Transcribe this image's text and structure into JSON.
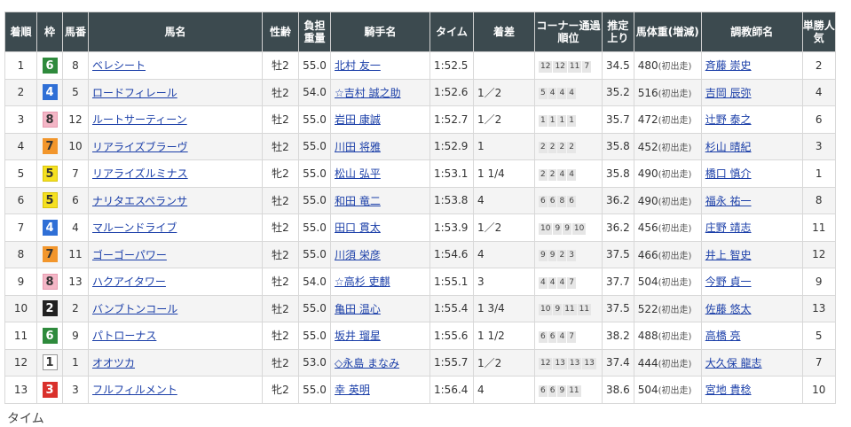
{
  "headers": [
    "着順",
    "枠",
    "馬番",
    "馬名",
    "性齢",
    "負担重量",
    "騎手名",
    "タイム",
    "着差",
    "コーナー通過順位",
    "推定上り",
    "馬体重(増減)",
    "調教師名",
    "単勝人気"
  ],
  "waku_colors": {
    "1": {
      "bg": "#ffffff",
      "fg": "#333333",
      "border": "#999999"
    },
    "2": {
      "bg": "#222222",
      "fg": "#ffffff",
      "border": "#222222"
    },
    "3": {
      "bg": "#d9302b",
      "fg": "#ffffff",
      "border": "#d9302b"
    },
    "4": {
      "bg": "#2f6fd6",
      "fg": "#ffffff",
      "border": "#2f6fd6"
    },
    "5": {
      "bg": "#f5e020",
      "fg": "#333333",
      "border": "#d9c40a"
    },
    "6": {
      "bg": "#2e8a3c",
      "fg": "#ffffff",
      "border": "#2e8a3c"
    },
    "7": {
      "bg": "#f2962c",
      "fg": "#333333",
      "border": "#f2962c"
    },
    "8": {
      "bg": "#f4b6c6",
      "fg": "#333333",
      "border": "#e79ab0"
    }
  },
  "rows": [
    {
      "pos": "1",
      "waku": "6",
      "num": "8",
      "name": "ベレシート",
      "sex": "牡2",
      "load": "55.0",
      "jockey": "北村 友一",
      "time": "1:52.5",
      "margin": "",
      "corner": [
        "12",
        "12",
        "11",
        "7"
      ],
      "last": "34.5",
      "weight": "480",
      "weight_diff": "(初出走)",
      "trainer": "斉藤 崇史",
      "pop": "2"
    },
    {
      "pos": "2",
      "waku": "4",
      "num": "5",
      "name": "ロードフィレール",
      "sex": "牡2",
      "load": "54.0",
      "jockey": "☆吉村 誠之助",
      "time": "1:52.6",
      "margin": "1／2",
      "corner": [
        "5",
        "4",
        "4",
        "4"
      ],
      "last": "35.2",
      "weight": "516",
      "weight_diff": "(初出走)",
      "trainer": "吉岡 辰弥",
      "pop": "4"
    },
    {
      "pos": "3",
      "waku": "8",
      "num": "12",
      "name": "ルートサーティーン",
      "sex": "牡2",
      "load": "55.0",
      "jockey": "岩田 康誠",
      "time": "1:52.7",
      "margin": "1／2",
      "corner": [
        "1",
        "1",
        "1",
        "1"
      ],
      "last": "35.7",
      "weight": "472",
      "weight_diff": "(初出走)",
      "trainer": "辻野 泰之",
      "pop": "6"
    },
    {
      "pos": "4",
      "waku": "7",
      "num": "10",
      "name": "リアライズブラーヴ",
      "sex": "牡2",
      "load": "55.0",
      "jockey": "川田 将雅",
      "time": "1:52.9",
      "margin": "1",
      "corner": [
        "2",
        "2",
        "2",
        "2"
      ],
      "last": "35.8",
      "weight": "452",
      "weight_diff": "(初出走)",
      "trainer": "杉山 晴紀",
      "pop": "3"
    },
    {
      "pos": "5",
      "waku": "5",
      "num": "7",
      "name": "リアライズルミナス",
      "sex": "牝2",
      "load": "55.0",
      "jockey": "松山 弘平",
      "time": "1:53.1",
      "margin": "1 1/4",
      "corner": [
        "2",
        "2",
        "4",
        "4"
      ],
      "last": "35.8",
      "weight": "490",
      "weight_diff": "(初出走)",
      "trainer": "橋口 慎介",
      "pop": "1"
    },
    {
      "pos": "6",
      "waku": "5",
      "num": "6",
      "name": "ナリタエスペランサ",
      "sex": "牡2",
      "load": "55.0",
      "jockey": "和田 竜二",
      "time": "1:53.8",
      "margin": "4",
      "corner": [
        "6",
        "6",
        "8",
        "6"
      ],
      "last": "36.2",
      "weight": "490",
      "weight_diff": "(初出走)",
      "trainer": "福永 祐一",
      "pop": "8"
    },
    {
      "pos": "7",
      "waku": "4",
      "num": "4",
      "name": "マルーンドライブ",
      "sex": "牡2",
      "load": "55.0",
      "jockey": "田口 貫太",
      "time": "1:53.9",
      "margin": "1／2",
      "corner": [
        "10",
        "9",
        "9",
        "10"
      ],
      "last": "36.2",
      "weight": "456",
      "weight_diff": "(初出走)",
      "trainer": "庄野 靖志",
      "pop": "11"
    },
    {
      "pos": "8",
      "waku": "7",
      "num": "11",
      "name": "ゴーゴーパワー",
      "sex": "牡2",
      "load": "55.0",
      "jockey": "川須 栄彦",
      "time": "1:54.6",
      "margin": "4",
      "corner": [
        "9",
        "9",
        "2",
        "3"
      ],
      "last": "37.5",
      "weight": "466",
      "weight_diff": "(初出走)",
      "trainer": "井上 智史",
      "pop": "12"
    },
    {
      "pos": "9",
      "waku": "8",
      "num": "13",
      "name": "ハクアイタワー",
      "sex": "牡2",
      "load": "54.0",
      "jockey": "☆高杉 吏麒",
      "time": "1:55.1",
      "margin": "3",
      "corner": [
        "4",
        "4",
        "4",
        "7"
      ],
      "last": "37.7",
      "weight": "504",
      "weight_diff": "(初出走)",
      "trainer": "今野 貞一",
      "pop": "9"
    },
    {
      "pos": "10",
      "waku": "2",
      "num": "2",
      "name": "バンブトンコール",
      "sex": "牡2",
      "load": "55.0",
      "jockey": "亀田 温心",
      "time": "1:55.4",
      "margin": "1 3/4",
      "corner": [
        "10",
        "9",
        "11",
        "11"
      ],
      "last": "37.5",
      "weight": "522",
      "weight_diff": "(初出走)",
      "trainer": "佐藤 悠太",
      "pop": "13"
    },
    {
      "pos": "11",
      "waku": "6",
      "num": "9",
      "name": "パトローナス",
      "sex": "牡2",
      "load": "55.0",
      "jockey": "坂井 瑠星",
      "time": "1:55.6",
      "margin": "1 1/2",
      "corner": [
        "6",
        "6",
        "4",
        "7"
      ],
      "last": "38.2",
      "weight": "488",
      "weight_diff": "(初出走)",
      "trainer": "高橋 亮",
      "pop": "5"
    },
    {
      "pos": "12",
      "waku": "1",
      "num": "1",
      "name": "オオツカ",
      "sex": "牡2",
      "load": "53.0",
      "jockey": "◇永島 まなみ",
      "time": "1:55.7",
      "margin": "1／2",
      "corner": [
        "12",
        "13",
        "13",
        "13"
      ],
      "last": "37.4",
      "weight": "444",
      "weight_diff": "(初出走)",
      "trainer": "大久保 龍志",
      "pop": "7"
    },
    {
      "pos": "13",
      "waku": "3",
      "num": "3",
      "name": "フルフィルメント",
      "sex": "牝2",
      "load": "55.0",
      "jockey": "幸 英明",
      "time": "1:56.4",
      "margin": "4",
      "corner": [
        "6",
        "6",
        "9",
        "11"
      ],
      "last": "38.6",
      "weight": "504",
      "weight_diff": "(初出走)",
      "trainer": "宮地 貴稔",
      "pop": "10"
    }
  ],
  "footer_text": "タイム"
}
